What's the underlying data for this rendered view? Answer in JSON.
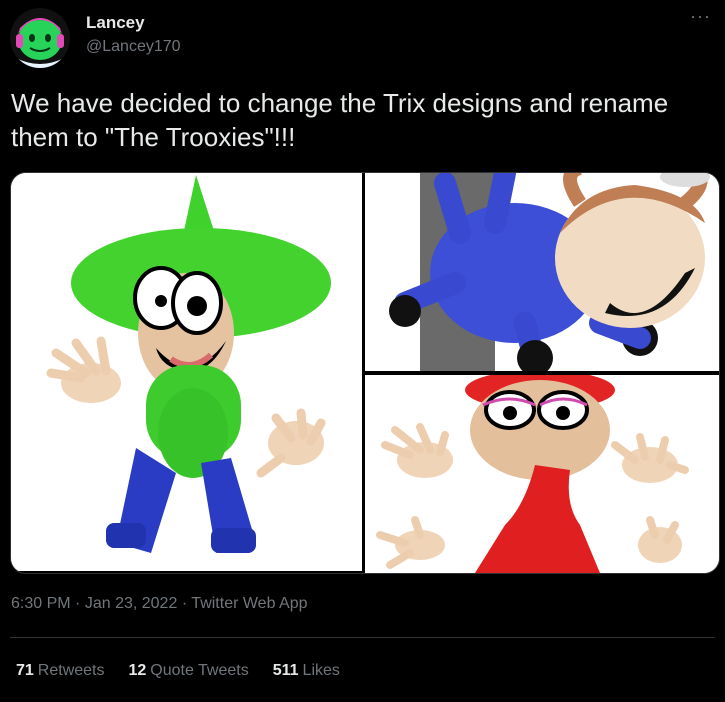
{
  "author": {
    "name": "Lancey",
    "handle": "@Lancey170"
  },
  "more_icon": "···",
  "tweet": {
    "text": "We have decided to change the Trix designs and rename them to \"The Trooxies\"!!!"
  },
  "meta": {
    "time": "6:30 PM",
    "sep1": "·",
    "date": "Jan 23, 2022",
    "sep2": "·",
    "client": "Twitter Web App"
  },
  "stats": {
    "retweets_count": "71",
    "retweets_label": "Retweets",
    "quotes_count": "12",
    "quotes_label": "Quote Tweets",
    "likes_count": "511",
    "likes_label": "Likes"
  },
  "colors": {
    "background": "#000000",
    "text_primary": "#e7e9ea",
    "text_secondary": "#71767b",
    "divider": "#2f3336"
  }
}
